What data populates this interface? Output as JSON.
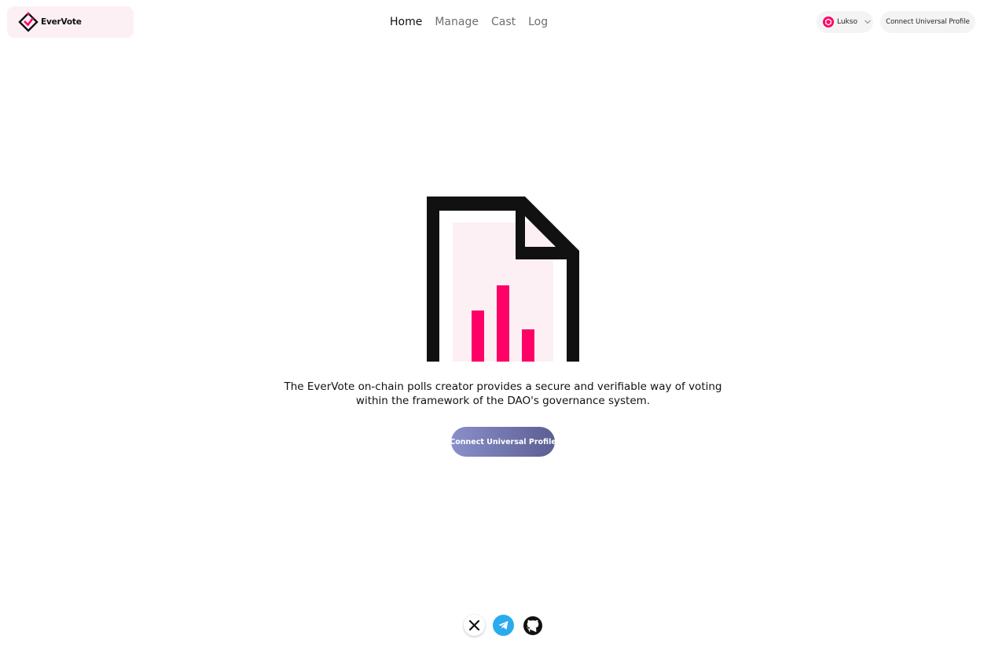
{
  "header": {
    "logo_text": "EverVote",
    "nav": [
      {
        "label": "Home",
        "active": true
      },
      {
        "label": "Manage",
        "active": false
      },
      {
        "label": "Cast",
        "active": false
      },
      {
        "label": "Log",
        "active": false
      }
    ],
    "network_label": "Lukso",
    "connect_label": "Connect Universal Profile"
  },
  "hero": {
    "description": "The EverVote on-chain polls creator provides a secure and verifiable way of voting within the framework of the DAO's governance system.",
    "cta_label": "Connect Universal Profile"
  },
  "footer": {
    "socials": [
      "x-icon",
      "telegram-icon",
      "github-icon"
    ]
  },
  "colors": {
    "accent": "#ff0066",
    "accent_light": "#fdf0f5",
    "button_gradient_start": "#8a8fcb",
    "button_gradient_end": "#5b5f92",
    "telegram": "#2aabee"
  }
}
